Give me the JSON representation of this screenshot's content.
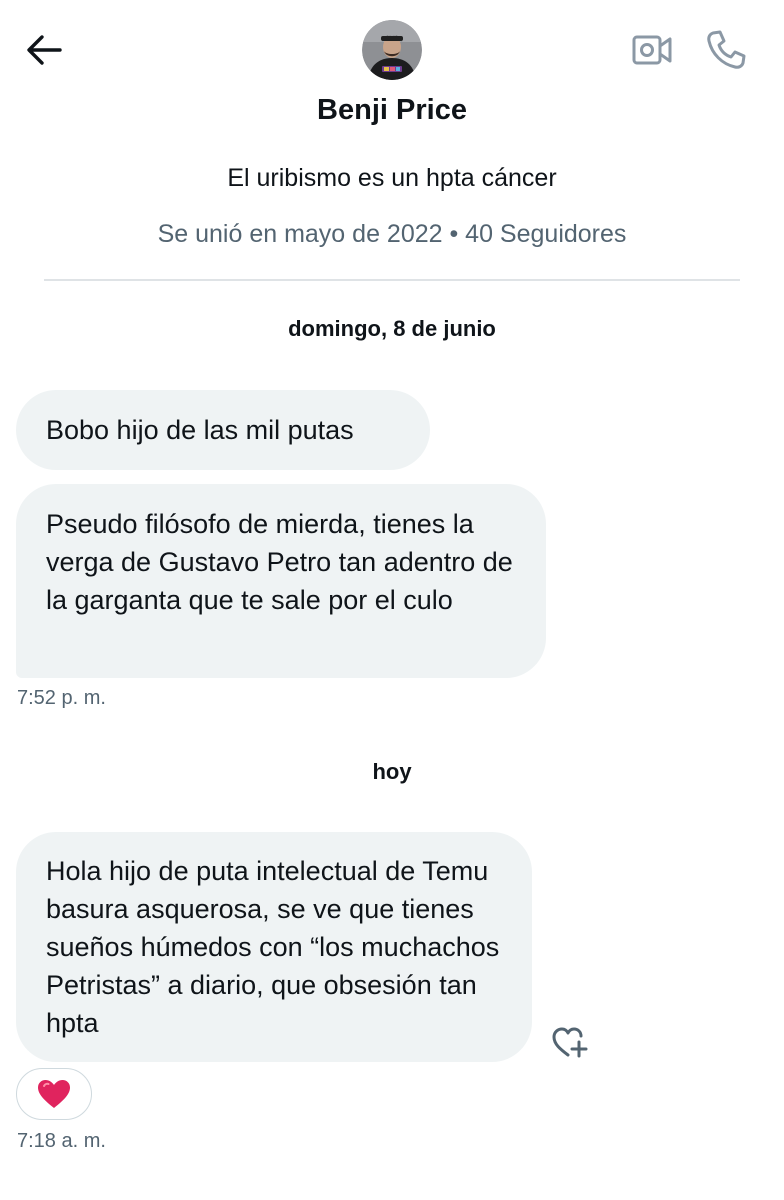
{
  "header": {
    "back_icon": "arrow-left-icon",
    "video_icon": "video-camera-icon",
    "phone_icon": "phone-icon",
    "avatar_icon": "user-avatar"
  },
  "profile": {
    "name": "Benji Price",
    "bio": "El uribismo es un hpta cáncer",
    "meta": "Se unió en mayo de 2022 • 40 Seguidores"
  },
  "conversation": {
    "groups": [
      {
        "date": "domingo, 8 de junio",
        "messages": [
          "Bobo hijo de las mil putas",
          "Pseudo filósofo de mierda, tienes la verga de Gustavo Petro tan adentro de la garganta que te sale por el culo"
        ],
        "time": "7:52 p. m."
      },
      {
        "date": "hoy",
        "messages": [
          "Hola hijo de puta intelectual de Temu basura asquerosa, se ve que tienes sueños húmedos con “los muchachos Petristas” a diario, que obsesión tan hpta"
        ],
        "reaction": "❤️",
        "react_icon": "heart-plus-icon",
        "time": "7:18 a. m."
      }
    ]
  },
  "colors": {
    "text": "#0f1419",
    "secondary_text": "#536471",
    "bubble_bg": "#eff3f4",
    "divider": "#dfe3e6",
    "icon_gray": "#8b98a5",
    "heart_red": "#e0245e"
  }
}
